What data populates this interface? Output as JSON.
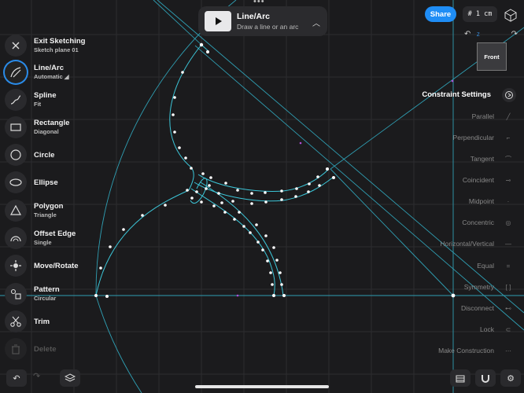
{
  "header": {
    "handle": "•••",
    "banner_title": "Line/Arc",
    "banner_subtitle": "Draw a line or an arc",
    "share_label": "Share",
    "grid_size": "# 1 cm"
  },
  "view_cube": {
    "face_label": "Front",
    "axis_z": "Z"
  },
  "toolbar": {
    "exit": {
      "label": "Exit Sketching",
      "sub": "Sketch plane 01"
    },
    "line_arc": {
      "label": "Line/Arc",
      "sub": "Automatic ◢"
    },
    "spline": {
      "label": "Spline",
      "sub": "Fit"
    },
    "rectangle": {
      "label": "Rectangle",
      "sub": "Diagonal"
    },
    "circle": {
      "label": "Circle"
    },
    "ellipse": {
      "label": "Ellipse"
    },
    "polygon": {
      "label": "Polygon",
      "sub": "Triangle"
    },
    "offset_edge": {
      "label": "Offset Edge",
      "sub": "Single"
    },
    "move_rotate": {
      "label": "Move/Rotate"
    },
    "pattern": {
      "label": "Pattern",
      "sub": "Circular"
    },
    "trim": {
      "label": "Trim"
    },
    "delete": {
      "label": "Delete"
    }
  },
  "constraints": {
    "title": "Constraint Settings",
    "items": [
      "Parallel",
      "Perpendicular",
      "Tangent",
      "Coincident",
      "Midpoint",
      "Concentric",
      "Horizontal/Vertical",
      "Equal",
      "Symmetry",
      "Disconnect",
      "Lock",
      "Make Construction"
    ]
  },
  "colors": {
    "accent": "#1f8df5",
    "sketch_line": "#3cc6d8",
    "background": "#1b1b1d"
  }
}
